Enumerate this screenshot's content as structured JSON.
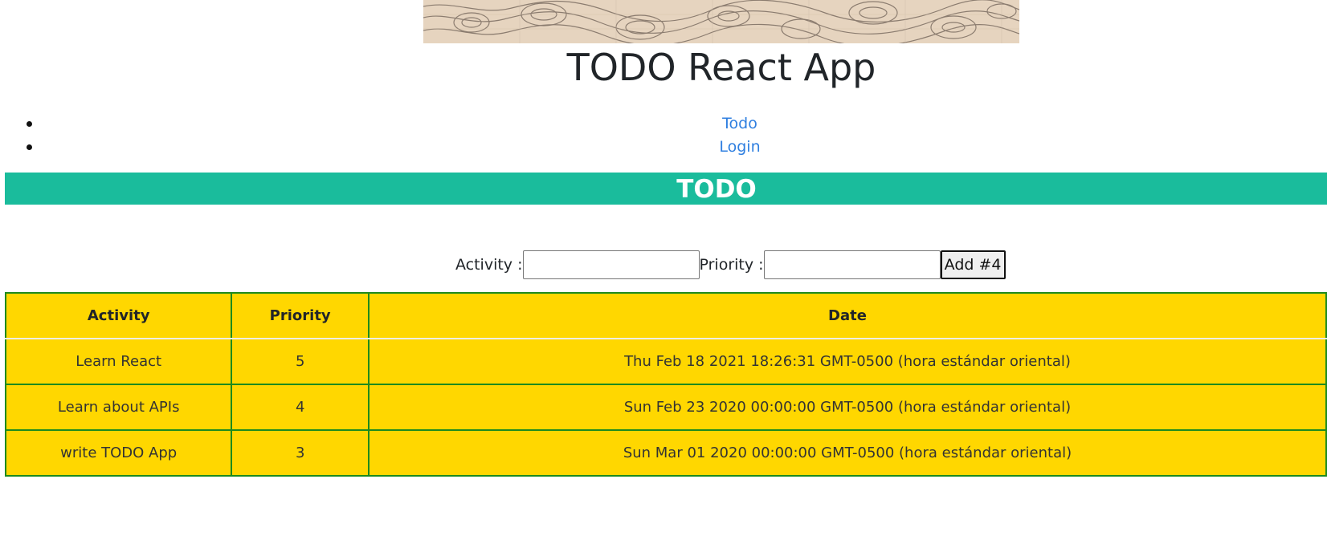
{
  "banner": {
    "icon": "topographic-map-image"
  },
  "app": {
    "title": "TODO React App"
  },
  "nav": {
    "items": [
      {
        "label": "Todo"
      },
      {
        "label": "Login"
      }
    ]
  },
  "section": {
    "title": "TODO"
  },
  "form": {
    "activity_label": "Activity :",
    "activity_value": "",
    "priority_label": "Priority :",
    "priority_value": "",
    "add_button_label": "Add #4"
  },
  "table": {
    "headers": [
      "Activity",
      "Priority",
      "Date"
    ],
    "rows": [
      {
        "activity": "Learn React",
        "priority": "5",
        "date": "Thu Feb 18 2021 18:26:31 GMT-0500 (hora estándar oriental)"
      },
      {
        "activity": "Learn about APIs",
        "priority": "4",
        "date": "Sun Feb 23 2020 00:00:00 GMT-0500 (hora estándar oriental)"
      },
      {
        "activity": "write TODO App",
        "priority": "3",
        "date": "Sun Mar 01 2020 00:00:00 GMT-0500 (hora estándar oriental)"
      }
    ]
  },
  "colors": {
    "section_bar": "#1abc9c",
    "table_background": "#ffd700",
    "table_border": "#1e8a1e",
    "link": "#2f7fe0"
  }
}
